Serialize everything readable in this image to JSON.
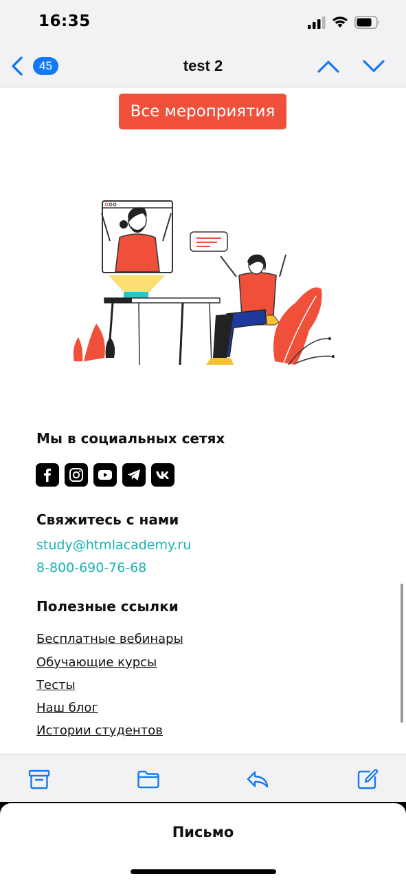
{
  "status": {
    "time": "16:35"
  },
  "nav": {
    "badge_count": "45",
    "title": "test 2"
  },
  "email": {
    "cta_label": "Все мероприятия",
    "social_title": "Мы в социальных сетях",
    "social_icons": [
      "facebook-icon",
      "instagram-icon",
      "youtube-icon",
      "telegram-icon",
      "vk-icon"
    ],
    "contact_title": "Свяжитесь с нами",
    "contact_email": "study@htmlacademy.ru",
    "contact_phone": "8-800-690-76-68",
    "links_title": "Полезные ссылки",
    "links": [
      "Бесплатные вебинары",
      "Обучающие курсы",
      "Тесты",
      "Наш блог",
      "Истории студентов"
    ]
  },
  "toolbar": {
    "icons": [
      "archive-icon",
      "folder-icon",
      "reply-icon",
      "compose-icon"
    ]
  },
  "sheet": {
    "title": "Письмо"
  },
  "colors": {
    "accent": "#1479f4",
    "cta": "#f0503a",
    "link_teal": "#16b4b0"
  }
}
